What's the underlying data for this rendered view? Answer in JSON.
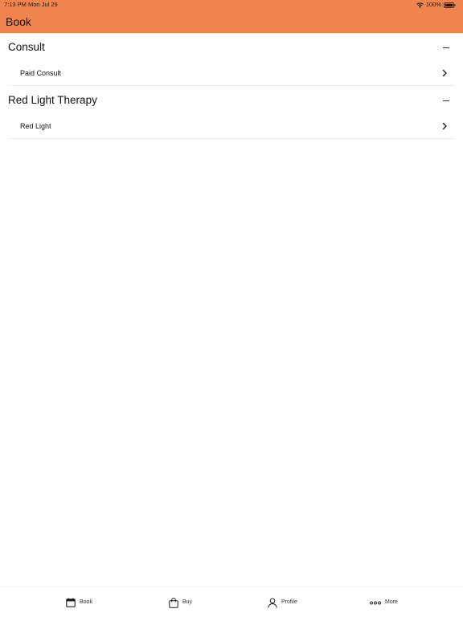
{
  "status_bar": {
    "time": "7:13 PM  Mon Jul 29",
    "battery": "100%"
  },
  "header": {
    "title": "Book"
  },
  "sections": [
    {
      "title": "Consult",
      "items": [
        {
          "label": "Paid Consult"
        }
      ]
    },
    {
      "title": "Red Light Therapy",
      "items": [
        {
          "label": "Red Light"
        }
      ]
    }
  ],
  "tabbar": {
    "tabs": [
      {
        "label": "Book",
        "icon": "calendar-icon"
      },
      {
        "label": "Buy",
        "icon": "shopping-bag-icon"
      },
      {
        "label": "Profile",
        "icon": "person-icon"
      },
      {
        "label": "More",
        "icon": "more-dots-icon"
      }
    ]
  },
  "colors": {
    "header_bg": "#F0844F",
    "text": "#111111",
    "divider": "#ECECEC"
  }
}
